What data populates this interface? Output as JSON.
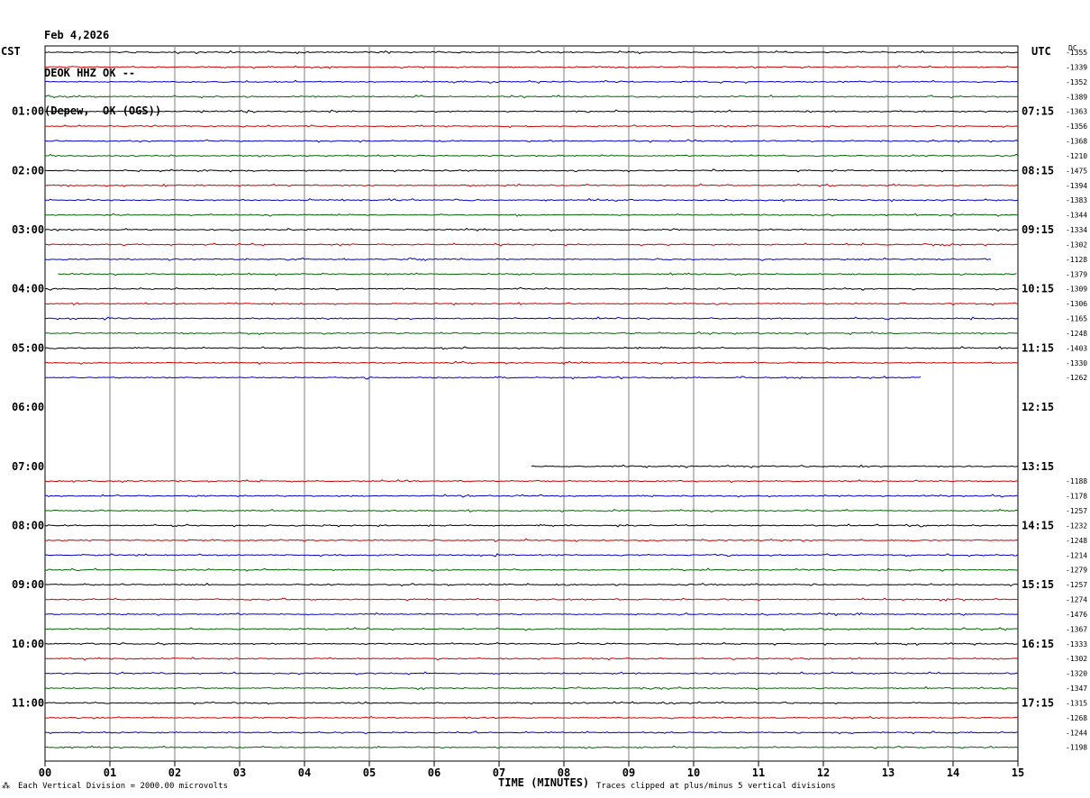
{
  "header": {
    "date": "Feb 4,2026",
    "station": "DEOK HHZ OK --",
    "location": "(Depew,  OK (OGS))"
  },
  "axis_labels": {
    "left_tz": "CST",
    "right_tz": "UTC",
    "dc_label": "DC",
    "x_title": "TIME (MINUTES)"
  },
  "footer": {
    "scale_note": "Each Vertical Division = 2000.00 microvolts",
    "clip_note": "Traces clipped at plus/minus 5 vertical divisions"
  },
  "colors": {
    "black": "#000000",
    "red": "#cc0000",
    "blue": "#0000cc",
    "green": "#006600",
    "grid": "#808080"
  },
  "chart_data": {
    "type": "line",
    "xlim": [
      0,
      15
    ],
    "x_ticks": [
      "00",
      "01",
      "02",
      "03",
      "04",
      "05",
      "06",
      "07",
      "08",
      "09",
      "10",
      "11",
      "12",
      "13",
      "14",
      "15"
    ],
    "rows_per_hour": 4,
    "left_hour_labels": [
      "01:00",
      "02:00",
      "03:00",
      "04:00",
      "05:00",
      "06:00",
      "07:00",
      "08:00",
      "09:00",
      "10:00",
      "11:00"
    ],
    "right_hour_labels": [
      "07:15",
      "08:15",
      "09:15",
      "10:15",
      "11:15",
      "12:15",
      "13:15",
      "14:15",
      "15:15",
      "16:15",
      "17:15"
    ],
    "traces": [
      {
        "color": "black",
        "dc": "-1355",
        "x_start": 0,
        "x_end": 15
      },
      {
        "color": "red",
        "dc": "-1339",
        "x_start": 0,
        "x_end": 15
      },
      {
        "color": "blue",
        "dc": "-1352",
        "x_start": 0,
        "x_end": 15
      },
      {
        "color": "green",
        "dc": "-1389",
        "x_start": 0,
        "x_end": 15
      },
      {
        "color": "black",
        "dc": "-1363",
        "x_start": 0,
        "x_end": 15
      },
      {
        "color": "red",
        "dc": "-1356",
        "x_start": 0,
        "x_end": 15
      },
      {
        "color": "blue",
        "dc": "-1368",
        "x_start": 0,
        "x_end": 15
      },
      {
        "color": "green",
        "dc": "-1210",
        "x_start": 0,
        "x_end": 15
      },
      {
        "color": "black",
        "dc": "-1475",
        "x_start": 0,
        "x_end": 15
      },
      {
        "color": "red",
        "dc": "-1394",
        "x_start": 0,
        "x_end": 15
      },
      {
        "color": "blue",
        "dc": "-1383",
        "x_start": 0,
        "x_end": 15
      },
      {
        "color": "green",
        "dc": "-1344",
        "x_start": 0,
        "x_end": 15
      },
      {
        "color": "black",
        "dc": "-1334",
        "x_start": 0,
        "x_end": 15
      },
      {
        "color": "red",
        "dc": "-1302",
        "x_start": 0,
        "x_end": 15
      },
      {
        "color": "blue",
        "dc": "-1128",
        "x_start": 0,
        "x_end": 14.6
      },
      {
        "color": "green",
        "dc": "-1379",
        "x_start": 0.2,
        "x_end": 15
      },
      {
        "color": "black",
        "dc": "-1309",
        "x_start": 0,
        "x_end": 15
      },
      {
        "color": "red",
        "dc": "-1306",
        "x_start": 0,
        "x_end": 15
      },
      {
        "color": "blue",
        "dc": "-1165",
        "x_start": 0,
        "x_end": 15
      },
      {
        "color": "green",
        "dc": "-1248",
        "x_start": 0,
        "x_end": 15
      },
      {
        "color": "black",
        "dc": "-1403",
        "x_start": 0,
        "x_end": 15
      },
      {
        "color": "red",
        "dc": "-1330",
        "x_start": 0,
        "x_end": 15
      },
      {
        "color": "blue",
        "dc": "-1262",
        "x_start": 0,
        "x_end": 13.5
      },
      {
        "color": "green",
        "dc": "",
        "x_start": 0,
        "x_end": 0
      },
      {
        "color": "black",
        "dc": "",
        "x_start": 0,
        "x_end": 0
      },
      {
        "color": "red",
        "dc": "",
        "x_start": 0,
        "x_end": 0
      },
      {
        "color": "blue",
        "dc": "",
        "x_start": 0,
        "x_end": 0
      },
      {
        "color": "green",
        "dc": "",
        "x_start": 0,
        "x_end": 0
      },
      {
        "color": "black",
        "dc": "",
        "x_start": 7.5,
        "x_end": 15
      },
      {
        "color": "red",
        "dc": "-1188",
        "x_start": 0,
        "x_end": 15
      },
      {
        "color": "blue",
        "dc": "-1178",
        "x_start": 0,
        "x_end": 15
      },
      {
        "color": "green",
        "dc": "-1257",
        "x_start": 0,
        "x_end": 15
      },
      {
        "color": "black",
        "dc": "-1232",
        "x_start": 0,
        "x_end": 15
      },
      {
        "color": "red",
        "dc": "-1248",
        "x_start": 0,
        "x_end": 15
      },
      {
        "color": "blue",
        "dc": "-1214",
        "x_start": 0,
        "x_end": 15
      },
      {
        "color": "green",
        "dc": "-1279",
        "x_start": 0,
        "x_end": 15
      },
      {
        "color": "black",
        "dc": "-1257",
        "x_start": 0,
        "x_end": 15
      },
      {
        "color": "red",
        "dc": "-1274",
        "x_start": 0,
        "x_end": 15
      },
      {
        "color": "blue",
        "dc": "-1476",
        "x_start": 0,
        "x_end": 15
      },
      {
        "color": "green",
        "dc": "-1367",
        "x_start": 0,
        "x_end": 15
      },
      {
        "color": "black",
        "dc": "-1333",
        "x_start": 0,
        "x_end": 15
      },
      {
        "color": "red",
        "dc": "-1302",
        "x_start": 0,
        "x_end": 15
      },
      {
        "color": "blue",
        "dc": "-1320",
        "x_start": 0,
        "x_end": 15
      },
      {
        "color": "green",
        "dc": "-1347",
        "x_start": 0,
        "x_end": 15
      },
      {
        "color": "black",
        "dc": "-1315",
        "x_start": 0,
        "x_end": 15
      },
      {
        "color": "red",
        "dc": "-1268",
        "x_start": 0,
        "x_end": 15
      },
      {
        "color": "blue",
        "dc": "-1244",
        "x_start": 0,
        "x_end": 15
      },
      {
        "color": "green",
        "dc": "-1198",
        "x_start": 0,
        "x_end": 15
      }
    ]
  }
}
